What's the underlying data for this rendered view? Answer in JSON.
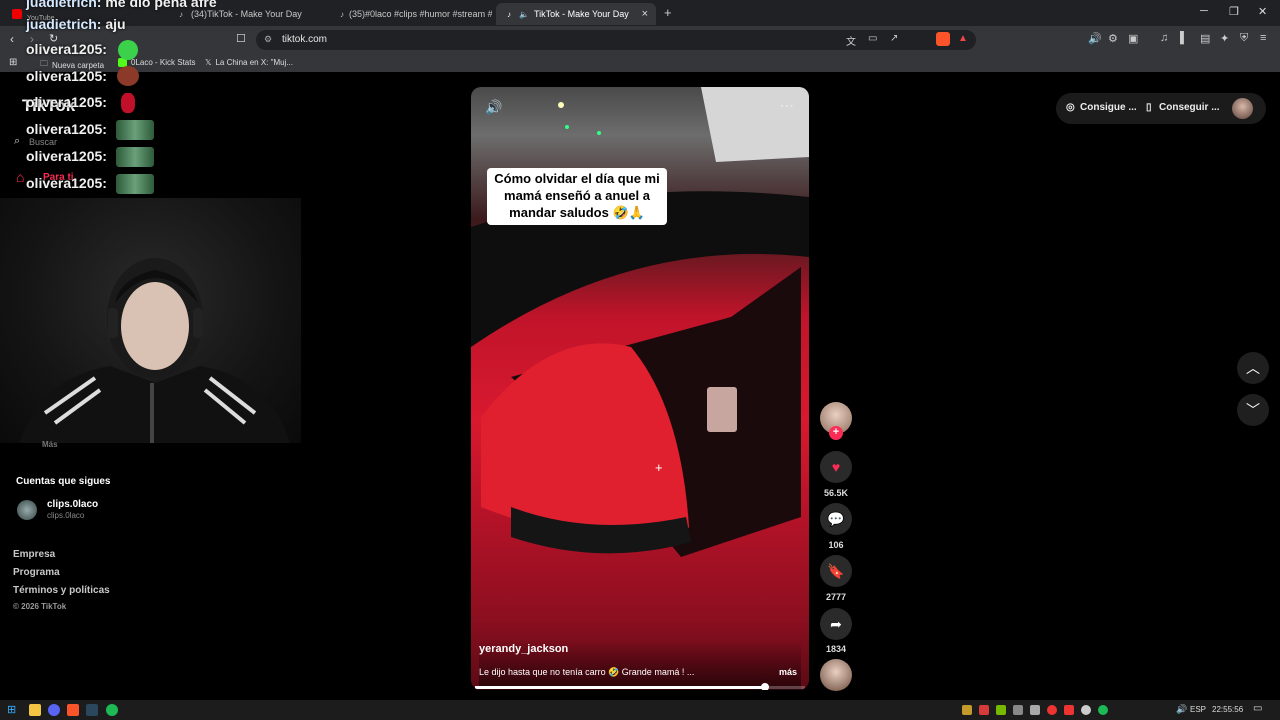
{
  "browser": {
    "tabs": [
      {
        "label": "(34)TikTok - Make Your Day"
      },
      {
        "label": "(35)#0laco #clips #humor #stream #"
      },
      {
        "label": "TikTok - Make Your Day"
      }
    ],
    "yt_tab_label": "YouTube",
    "new_tab": "+",
    "url": "tiktok.com",
    "bookmarks": [
      {
        "label": "Nueva carpeta"
      },
      {
        "label": "0Laco - Kick Stats"
      },
      {
        "label": "La China en X: \"Muj..."
      }
    ]
  },
  "chat": {
    "messages": [
      {
        "user": "juadietrich:",
        "text": " me dio pena afre"
      },
      {
        "user": "juadietrich:",
        "text": " aju"
      },
      {
        "user": "olivera1205:",
        "text": ""
      },
      {
        "user": "olivera1205:",
        "text": ""
      },
      {
        "user": "olivera1205:",
        "text": ""
      },
      {
        "user": "olivera1205:",
        "text": ""
      },
      {
        "user": "olivera1205:",
        "text": ""
      },
      {
        "user": "olivera1205:",
        "text": ""
      }
    ]
  },
  "sidebar": {
    "logo": "TikTok",
    "search_placeholder": "Buscar",
    "for_you": "Para ti",
    "more": "Más",
    "following_header": "Cuentas que sigues",
    "following": {
      "name": "clips.0laco",
      "handle": "clips.0laco"
    },
    "footer": [
      "Empresa",
      "Programa",
      "Términos y políticas"
    ],
    "copyright": "© 2026 TikTok"
  },
  "video": {
    "caption_overlay": "Cómo olvidar el día que mi mamá enseñó a anuel a mandar saludos 🤣🙏",
    "author": "yerandy_jackson",
    "description": "Le dijo hasta que no tenía carro 🤣 Grande mamá ! ...",
    "more": "más",
    "progress": 0.88
  },
  "actions": {
    "likes": "56.5K",
    "comments": "106",
    "saves": "2777",
    "shares": "1834"
  },
  "top_right": {
    "coins": "Consigue ...",
    "app": "Conseguir ..."
  },
  "taskbar": {
    "lang": "ESP",
    "time": "22:55:56"
  },
  "colors": {
    "accent": "#fe2c55",
    "background": "#000000"
  }
}
